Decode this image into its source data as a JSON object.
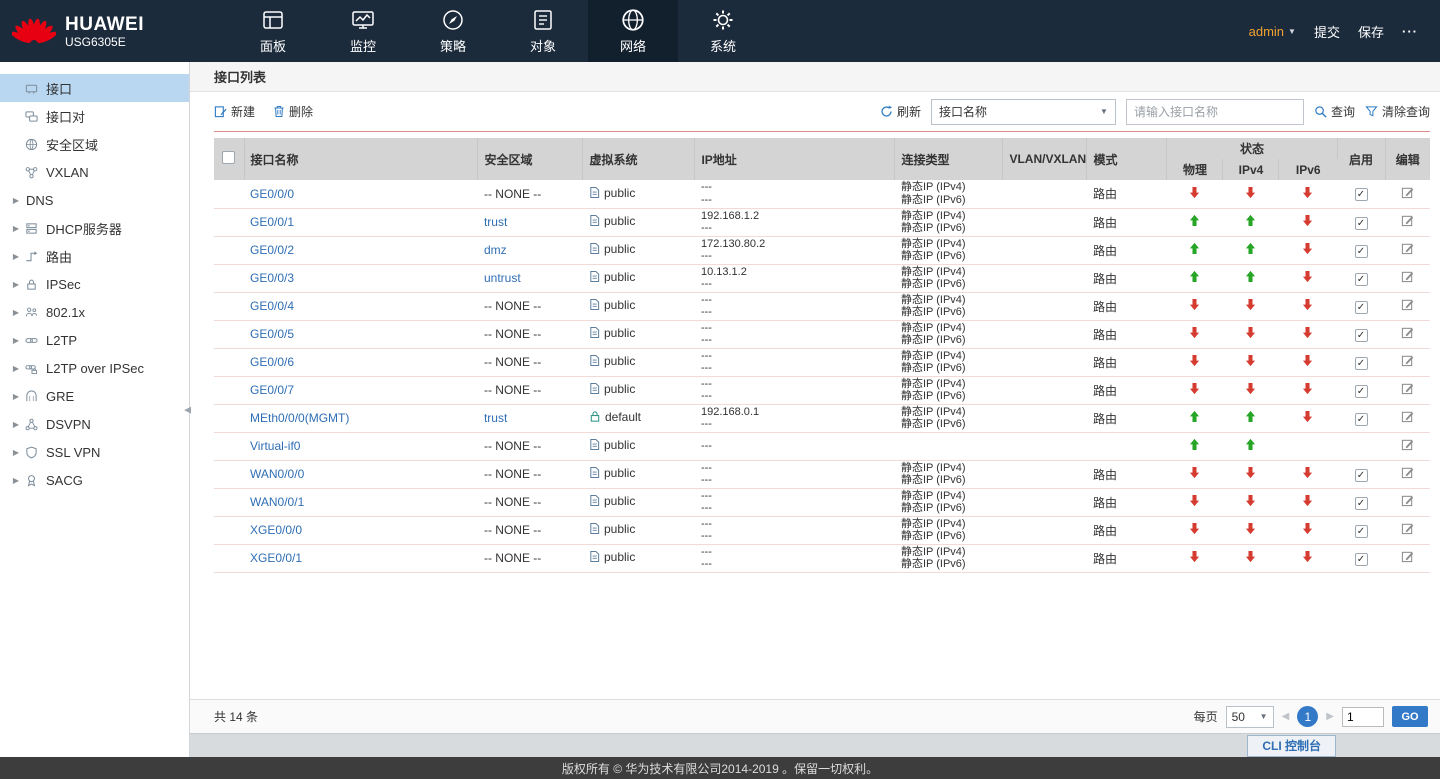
{
  "colors": {
    "brand_red": "#e60012",
    "topbar_bg": "#1c2b3c",
    "accent_blue": "#2f7cc4",
    "link_blue": "#2f6eb4",
    "status_up_green": "#26a526",
    "status_down_red": "#d63b30",
    "header_gray": "#d4d4d4",
    "sidebar_active_blue": "#b9d7f1",
    "pagination_blue": "#3279c8"
  },
  "brand": {
    "name": "HUAWEI",
    "model": "USG6305E"
  },
  "topnav": {
    "user": "admin",
    "submit_label": "提交",
    "save_label": "保存",
    "more_label": "···",
    "items": [
      {
        "id": "dashboard",
        "label": "面板",
        "icon": "panel-icon"
      },
      {
        "id": "monitor",
        "label": "监控",
        "icon": "monitor-icon"
      },
      {
        "id": "policy",
        "label": "策略",
        "icon": "policy-icon"
      },
      {
        "id": "object",
        "label": "对象",
        "icon": "object-icon"
      },
      {
        "id": "network",
        "label": "网络",
        "icon": "network-icon",
        "active": true
      },
      {
        "id": "system",
        "label": "系统",
        "icon": "system-icon"
      }
    ]
  },
  "sidebar": {
    "items": [
      {
        "id": "interface",
        "label": "接口",
        "icon": "interface-icon",
        "active": true
      },
      {
        "id": "interface-pair",
        "label": "接口对",
        "icon": "pair-icon"
      },
      {
        "id": "security-zone",
        "label": "安全区域",
        "icon": "zone-icon"
      },
      {
        "id": "vxlan",
        "label": "VXLAN",
        "icon": "vxlan-icon"
      },
      {
        "id": "dns",
        "label": "DNS",
        "expandable": true
      },
      {
        "id": "dhcp-server",
        "label": "DHCP服务器",
        "icon": "dhcp-icon",
        "expandable": true
      },
      {
        "id": "route",
        "label": "路由",
        "icon": "route-icon",
        "expandable": true
      },
      {
        "id": "ipsec",
        "label": "IPSec",
        "icon": "ipsec-icon",
        "expandable": true
      },
      {
        "id": "dot1x",
        "label": "802.1x",
        "icon": "dot1x-icon",
        "expandable": true
      },
      {
        "id": "l2tp",
        "label": "L2TP",
        "icon": "l2tp-icon",
        "expandable": true
      },
      {
        "id": "l2tp-over-ipsec",
        "label": "L2TP over IPSec",
        "icon": "l2tp-ipsec-icon",
        "expandable": true
      },
      {
        "id": "gre",
        "label": "GRE",
        "icon": "gre-icon",
        "expandable": true
      },
      {
        "id": "dsvpn",
        "label": "DSVPN",
        "icon": "dsvpn-icon",
        "expandable": true
      },
      {
        "id": "ssl-vpn",
        "label": "SSL VPN",
        "icon": "sslvpn-icon",
        "expandable": true
      },
      {
        "id": "sacg",
        "label": "SACG",
        "icon": "sacg-icon",
        "expandable": true
      }
    ]
  },
  "main": {
    "title": "接口列表",
    "toolbar": {
      "new_label": "新建",
      "delete_label": "删除",
      "refresh_label": "刷新",
      "filter_field": "接口名称",
      "search_placeholder": "请输入接口名称",
      "query_label": "查询",
      "clear_label": "清除查询"
    },
    "table": {
      "headers": {
        "name": "接口名称",
        "zone": "安全区域",
        "vsys": "虚拟系统",
        "ip": "IP地址",
        "conn": "连接类型",
        "vlan": "VLAN/VXLAN",
        "mode": "模式",
        "status": "状态",
        "phy": "物理",
        "ipv4": "IPv4",
        "ipv6": "IPv6",
        "enable": "启用",
        "edit": "编辑"
      },
      "rows": [
        {
          "name": "GE0/0/0",
          "zone": "-- NONE --",
          "zone_link": false,
          "vsys": "public",
          "vsys_icon": "doc",
          "ip": [
            "---",
            "---"
          ],
          "conn": [
            "静态IP (IPv4)",
            "静态IP (IPv6)"
          ],
          "vlan": "",
          "mode": "路由",
          "phy": "down",
          "ipv4": "down",
          "ipv6": "down",
          "enabled": true
        },
        {
          "name": "GE0/0/1",
          "zone": "trust",
          "zone_link": true,
          "vsys": "public",
          "vsys_icon": "doc",
          "ip": [
            "192.168.1.2",
            "---"
          ],
          "conn": [
            "静态IP (IPv4)",
            "静态IP (IPv6)"
          ],
          "vlan": "",
          "mode": "路由",
          "phy": "up",
          "ipv4": "up",
          "ipv6": "down",
          "enabled": true
        },
        {
          "name": "GE0/0/2",
          "zone": "dmz",
          "zone_link": true,
          "vsys": "public",
          "vsys_icon": "doc",
          "ip": [
            "172.130.80.2",
            "---"
          ],
          "conn": [
            "静态IP (IPv4)",
            "静态IP (IPv6)"
          ],
          "vlan": "",
          "mode": "路由",
          "phy": "up",
          "ipv4": "up",
          "ipv6": "down",
          "enabled": true
        },
        {
          "name": "GE0/0/3",
          "zone": "untrust",
          "zone_link": true,
          "vsys": "public",
          "vsys_icon": "doc",
          "ip": [
            "10.13.1.2",
            "---"
          ],
          "conn": [
            "静态IP (IPv4)",
            "静态IP (IPv6)"
          ],
          "vlan": "",
          "mode": "路由",
          "phy": "up",
          "ipv4": "up",
          "ipv6": "down",
          "enabled": true
        },
        {
          "name": "GE0/0/4",
          "zone": "-- NONE --",
          "zone_link": false,
          "vsys": "public",
          "vsys_icon": "doc",
          "ip": [
            "---",
            "---"
          ],
          "conn": [
            "静态IP (IPv4)",
            "静态IP (IPv6)"
          ],
          "vlan": "",
          "mode": "路由",
          "phy": "down",
          "ipv4": "down",
          "ipv6": "down",
          "enabled": true
        },
        {
          "name": "GE0/0/5",
          "zone": "-- NONE --",
          "zone_link": false,
          "vsys": "public",
          "vsys_icon": "doc",
          "ip": [
            "---",
            "---"
          ],
          "conn": [
            "静态IP (IPv4)",
            "静态IP (IPv6)"
          ],
          "vlan": "",
          "mode": "路由",
          "phy": "down",
          "ipv4": "down",
          "ipv6": "down",
          "enabled": true
        },
        {
          "name": "GE0/0/6",
          "zone": "-- NONE --",
          "zone_link": false,
          "vsys": "public",
          "vsys_icon": "doc",
          "ip": [
            "---",
            "---"
          ],
          "conn": [
            "静态IP (IPv4)",
            "静态IP (IPv6)"
          ],
          "vlan": "",
          "mode": "路由",
          "phy": "down",
          "ipv4": "down",
          "ipv6": "down",
          "enabled": true
        },
        {
          "name": "GE0/0/7",
          "zone": "-- NONE --",
          "zone_link": false,
          "vsys": "public",
          "vsys_icon": "doc",
          "ip": [
            "---",
            "---"
          ],
          "conn": [
            "静态IP (IPv4)",
            "静态IP (IPv6)"
          ],
          "vlan": "",
          "mode": "路由",
          "phy": "down",
          "ipv4": "down",
          "ipv6": "down",
          "enabled": true
        },
        {
          "name": "MEth0/0/0(MGMT)",
          "zone": "trust",
          "zone_link": true,
          "vsys": "default",
          "vsys_icon": "lock",
          "ip": [
            "192.168.0.1",
            "---"
          ],
          "conn": [
            "静态IP (IPv4)",
            "静态IP (IPv6)"
          ],
          "vlan": "",
          "mode": "路由",
          "phy": "up",
          "ipv4": "up",
          "ipv6": "down",
          "enabled": true
        },
        {
          "name": "Virtual-if0",
          "zone": "-- NONE --",
          "zone_link": false,
          "vsys": "public",
          "vsys_icon": "doc",
          "ip": [
            "---"
          ],
          "conn": [],
          "vlan": "",
          "mode": "",
          "phy": "up",
          "ipv4": "up",
          "ipv6": "",
          "enabled": null
        },
        {
          "name": "WAN0/0/0",
          "zone": "-- NONE --",
          "zone_link": false,
          "vsys": "public",
          "vsys_icon": "doc",
          "ip": [
            "---",
            "---"
          ],
          "conn": [
            "静态IP (IPv4)",
            "静态IP (IPv6)"
          ],
          "vlan": "",
          "mode": "路由",
          "phy": "down",
          "ipv4": "down",
          "ipv6": "down",
          "enabled": true
        },
        {
          "name": "WAN0/0/1",
          "zone": "-- NONE --",
          "zone_link": false,
          "vsys": "public",
          "vsys_icon": "doc",
          "ip": [
            "---",
            "---"
          ],
          "conn": [
            "静态IP (IPv4)",
            "静态IP (IPv6)"
          ],
          "vlan": "",
          "mode": "路由",
          "phy": "down",
          "ipv4": "down",
          "ipv6": "down",
          "enabled": true
        },
        {
          "name": "XGE0/0/0",
          "zone": "-- NONE --",
          "zone_link": false,
          "vsys": "public",
          "vsys_icon": "doc",
          "ip": [
            "---",
            "---"
          ],
          "conn": [
            "静态IP (IPv4)",
            "静态IP (IPv6)"
          ],
          "vlan": "",
          "mode": "路由",
          "phy": "down",
          "ipv4": "down",
          "ipv6": "down",
          "enabled": true
        },
        {
          "name": "XGE0/0/1",
          "zone": "-- NONE --",
          "zone_link": false,
          "vsys": "public",
          "vsys_icon": "doc",
          "ip": [
            "---",
            "---"
          ],
          "conn": [
            "静态IP (IPv4)",
            "静态IP (IPv6)"
          ],
          "vlan": "",
          "mode": "路由",
          "phy": "down",
          "ipv4": "down",
          "ipv6": "down",
          "enabled": true
        }
      ]
    },
    "footer": {
      "total": "共 14 条",
      "per_page_label": "每页",
      "per_page_value": "50",
      "current_page": "1",
      "goto_value": "1",
      "go_label": "GO"
    }
  },
  "cli": {
    "label": "CLI 控制台"
  },
  "footer": {
    "copyright": "版权所有 © 华为技术有限公司2014-2019 。保留一切权利。"
  }
}
